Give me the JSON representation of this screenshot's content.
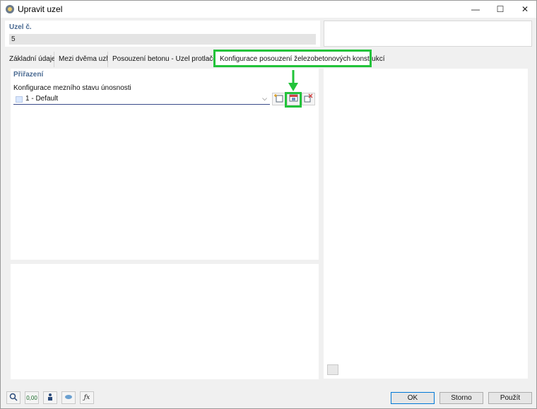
{
  "window": {
    "title": "Upravit uzel",
    "minimize": "—",
    "maximize": "☐",
    "close": "✕"
  },
  "uzel": {
    "label": "Uzel č.",
    "value": "5"
  },
  "tabs": [
    {
      "label": "Základní údaje"
    },
    {
      "label": "Mezi dvěma uzly"
    },
    {
      "label": "Posouzení betonu - Uzel protlačení"
    },
    {
      "label": "Konfigurace posouzení železobetonových konstrukcí",
      "active": true
    }
  ],
  "assignment": {
    "section_label": "Přiřazení",
    "config_label": "Konfigurace mezního stavu únosnosti",
    "selected_value": "1 - Default",
    "swatch_color": "#d9e7ff",
    "tools": [
      "new-config-icon",
      "edit-config-icon",
      "select-from-model-icon"
    ]
  },
  "footer": {
    "icons": [
      "search-icon",
      "units-icon",
      "user-icon",
      "hat-icon",
      "function-icon"
    ],
    "units_text": "0,00",
    "function_text": "ƒx",
    "ok": "OK",
    "storno": "Storno",
    "pouzit": "Použít"
  },
  "colors": {
    "highlight": "#22c33a",
    "label_blue": "#4a6a92"
  }
}
